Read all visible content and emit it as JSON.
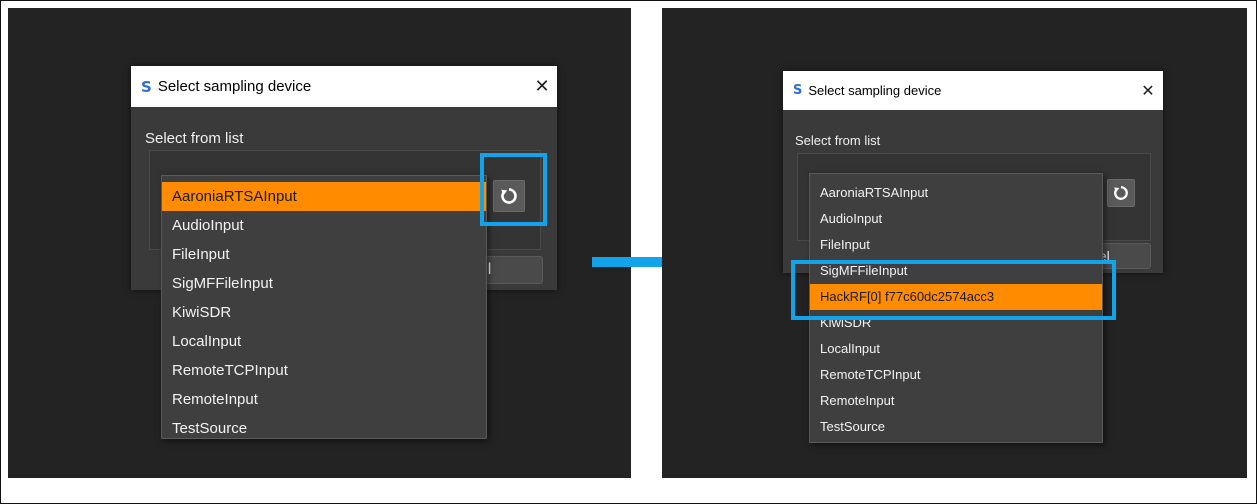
{
  "dialog": {
    "title": "Select sampling device",
    "app_icon": "S",
    "close": "✕",
    "section_label": "Select from list",
    "cancel_label_partial": "ncel",
    "cancel_label_partial_right": "ncel"
  },
  "left": {
    "devices": [
      "AaroniaRTSAInput",
      "AudioInput",
      "FileInput",
      "SigMFFileInput",
      "KiwiSDR",
      "LocalInput",
      "RemoteTCPInput",
      "RemoteInput",
      "TestSource"
    ],
    "selected_index": 0
  },
  "right": {
    "devices": [
      "AaroniaRTSAInput",
      "AudioInput",
      "FileInput",
      "SigMFFileInput",
      "HackRF[0] f77c60dc2574acc3",
      "KiwiSDR",
      "LocalInput",
      "RemoteTCPInput",
      "RemoteInput",
      "TestSource"
    ],
    "selected_index": 4
  },
  "colors": {
    "highlight": "#12a4ea",
    "selection": "#ff8c00",
    "background": "#232323"
  },
  "icons": {
    "refresh": "refresh-icon",
    "arrow": "right-arrow-icon"
  }
}
